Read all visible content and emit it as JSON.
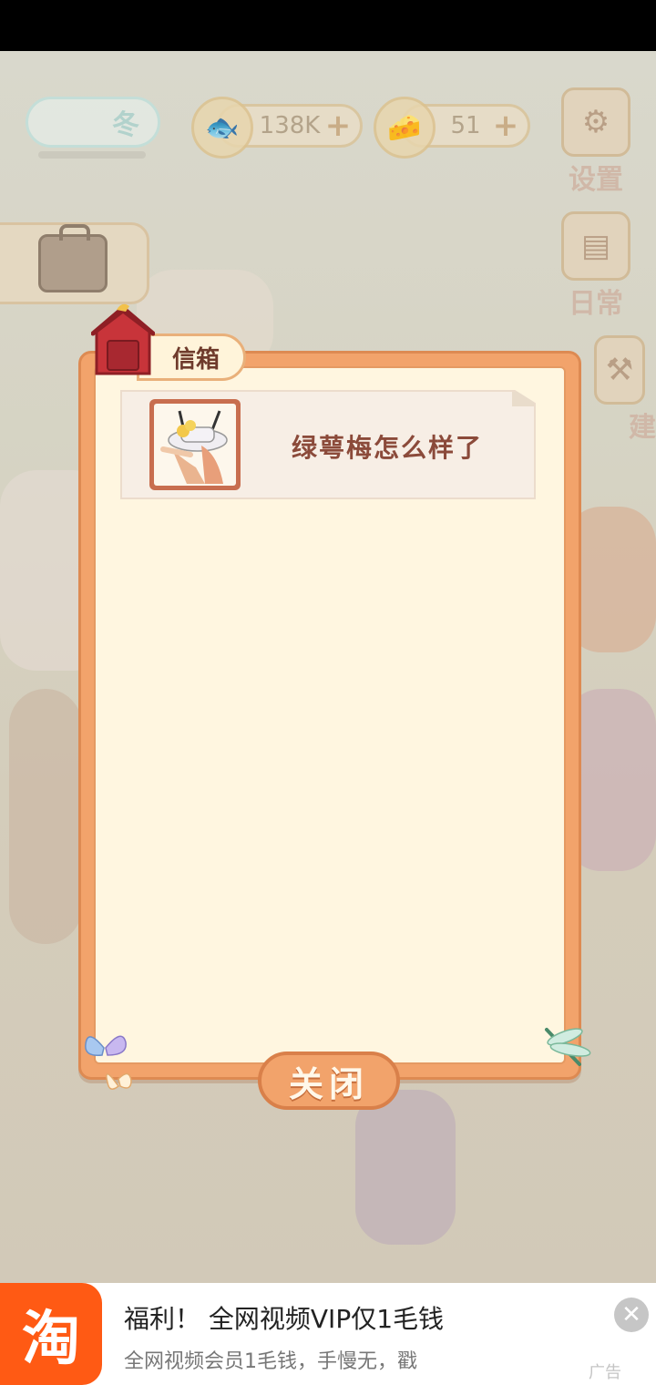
{
  "hud": {
    "season_label": "冬",
    "fish_count": "138K",
    "cheese_count": "51",
    "plus_symbol": "+",
    "settings_label": "设置",
    "daily_label": "日常",
    "build_label": "建"
  },
  "mailbox": {
    "title": "信箱",
    "items": [
      {
        "subject": "绿萼梅怎么样了"
      }
    ],
    "close_label": "关闭"
  },
  "ad": {
    "logo_text": "淘",
    "title": "福利！ 全网视频VIP仅1毛钱",
    "description": "全网视频会员1毛钱，手慢无，戳",
    "close_symbol": "✕",
    "label": "广告"
  },
  "colors": {
    "dialog_border": "#f2a36b",
    "dialog_fill": "#fff6e0",
    "ad_brand": "#ff5a14"
  }
}
